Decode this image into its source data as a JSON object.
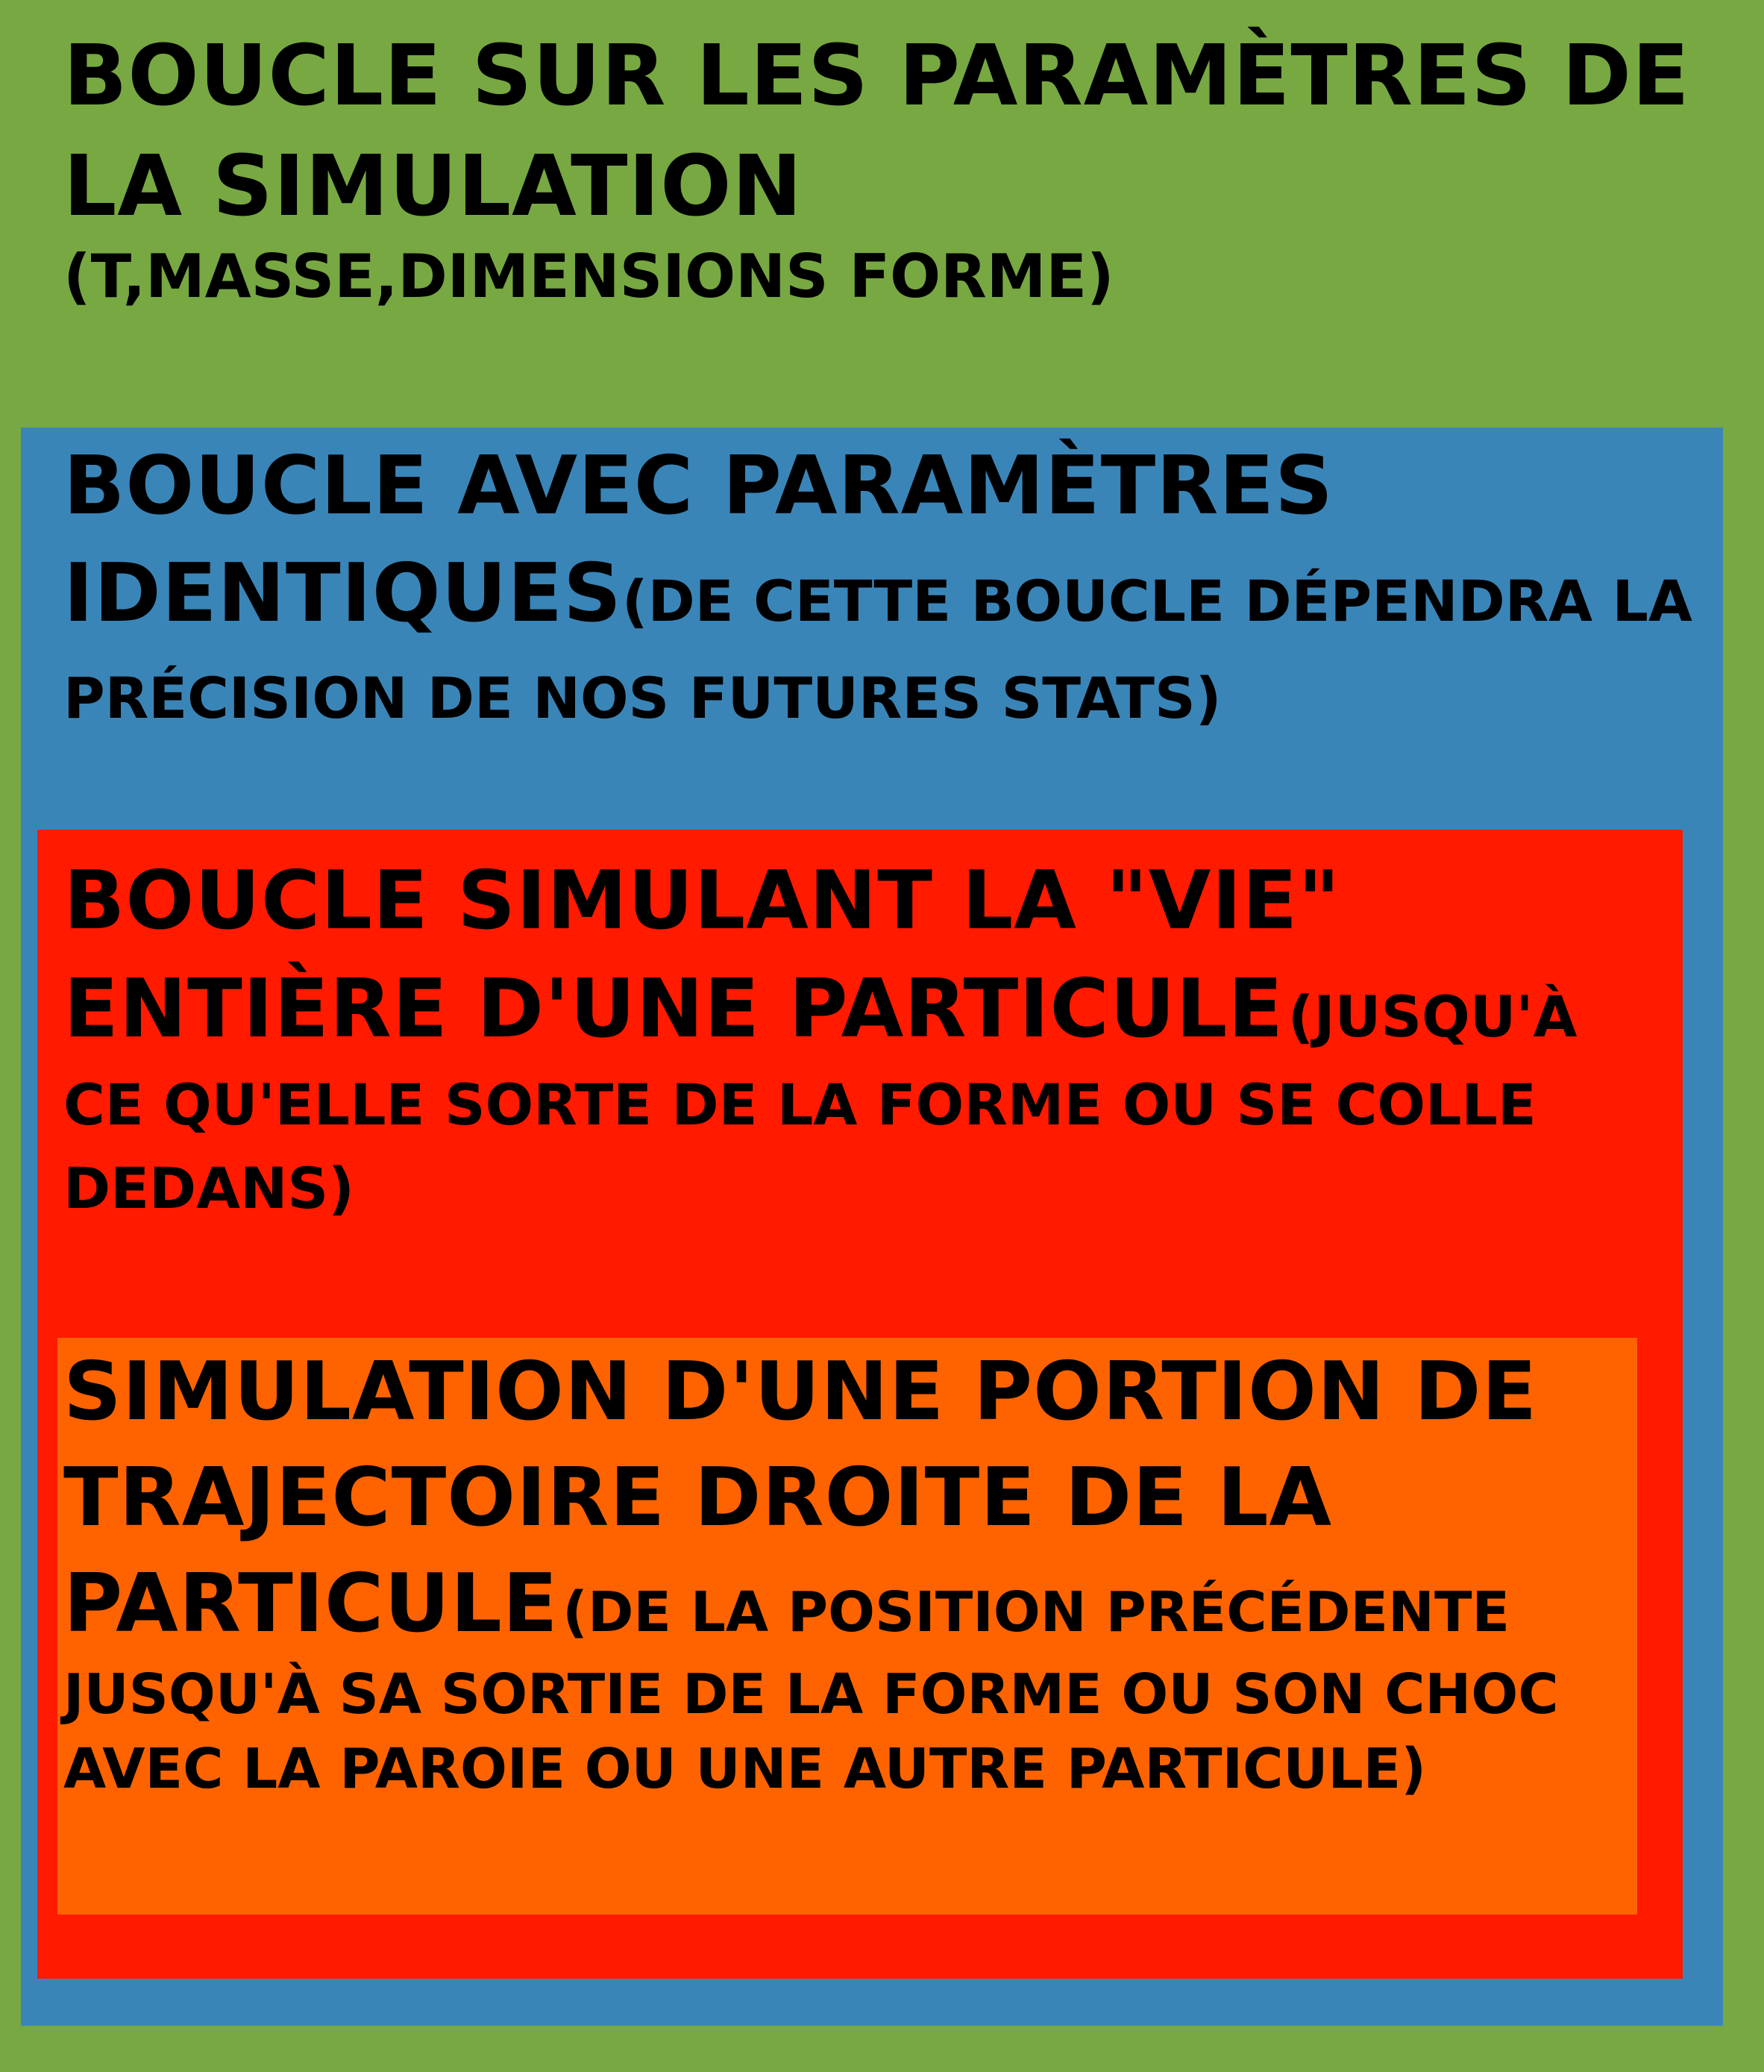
{
  "colors": {
    "level1": "#78a842",
    "level2": "#3a85b8",
    "level3": "#ff1a00",
    "level4": "#ff6300"
  },
  "boxes": {
    "level1": {
      "title": "Boucle sur les paramètres de la simulation",
      "detail": "T,masse,dimensions forme"
    },
    "level2": {
      "title": "Boucle avec paramètres identiques",
      "detail": "De cette boucle dépendra la précision de nos futures stats"
    },
    "level3": {
      "title": "Boucle simulant la \"vie\" entière d'une particule",
      "detail": "Jusqu'à ce qu'elle sorte de la forme ou se colle dedans"
    },
    "level4": {
      "title": "Simulation d'une portion de trajectoire droite de la particule",
      "detail": "De la position précédente jusqu'à sa sortie de la forme ou son choc avec la paroie ou une autre particule"
    }
  }
}
